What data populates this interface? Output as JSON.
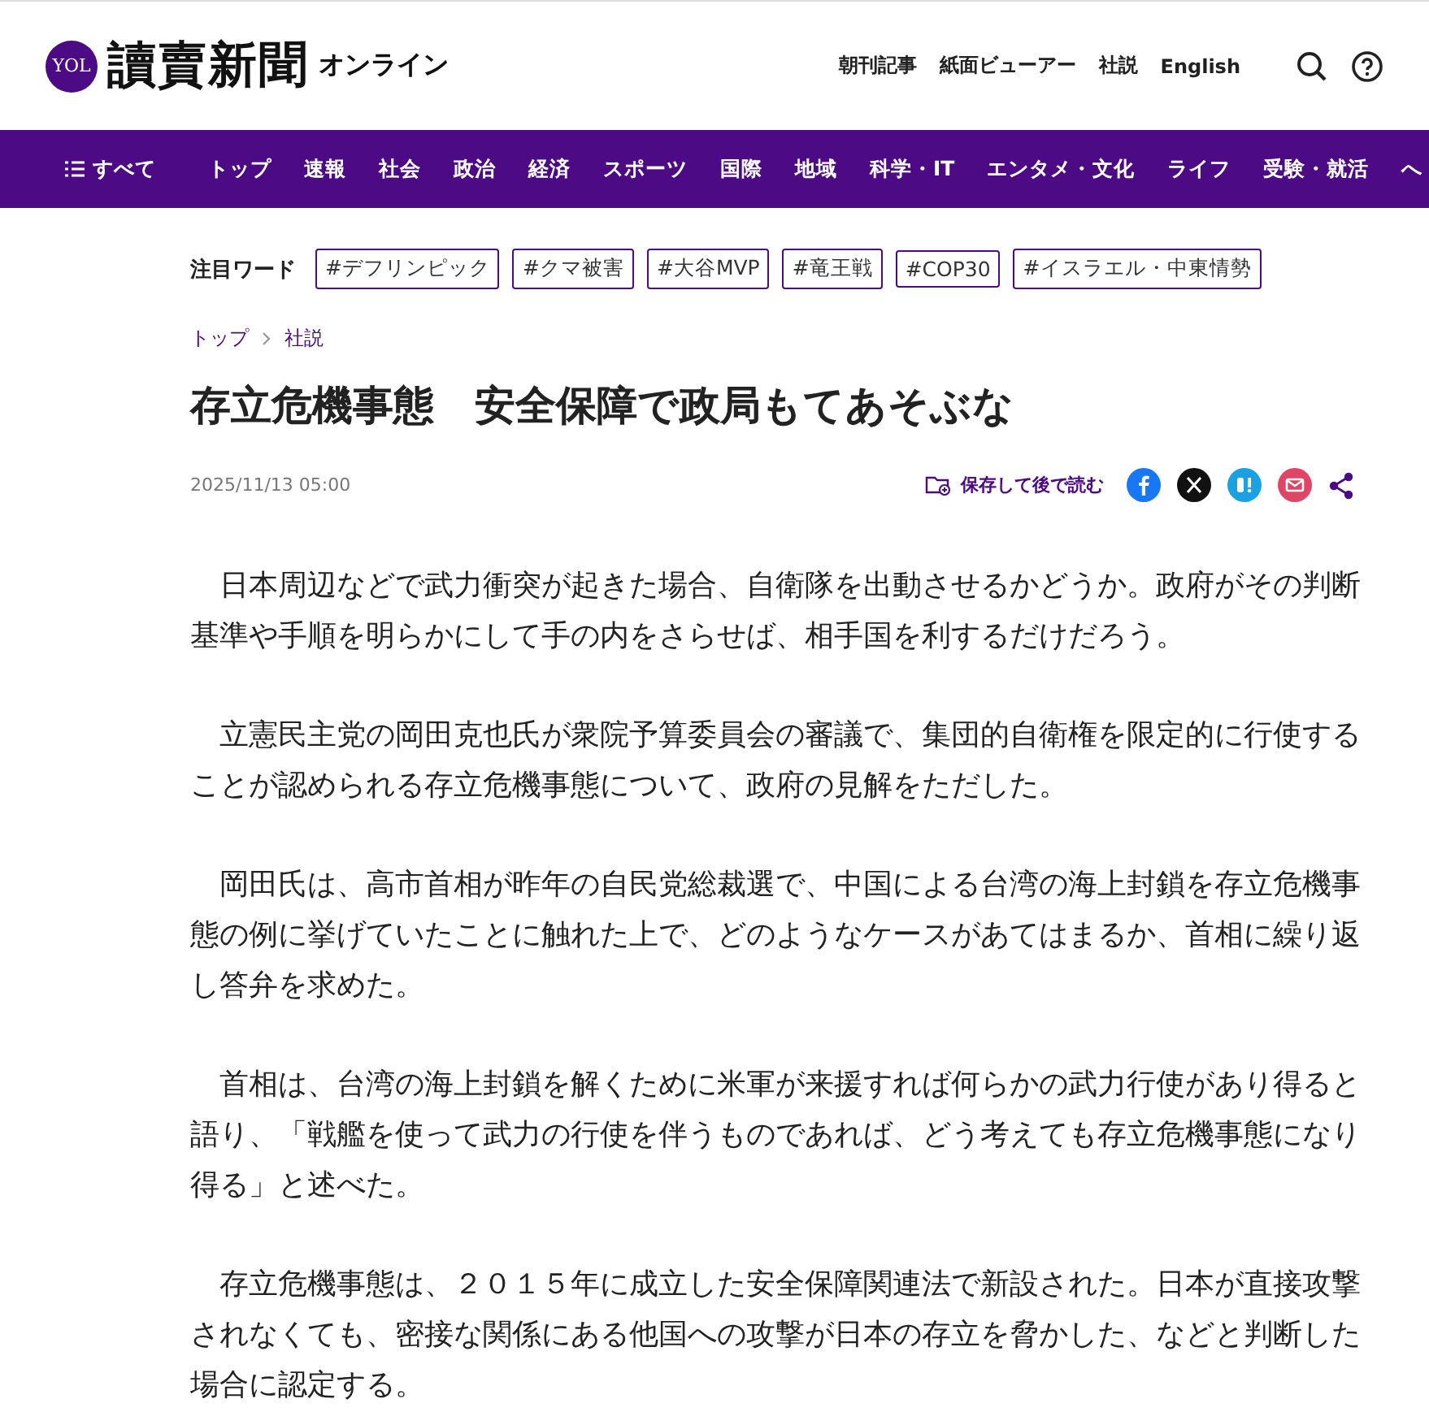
{
  "header": {
    "logo_mark": "YOL",
    "logo_title": "讀賣新聞",
    "logo_sub": "オンライン",
    "links": [
      "朝刊記事",
      "紙面ビューアー",
      "社説",
      "English"
    ]
  },
  "nav": {
    "menu_label": "すべて",
    "items": [
      "トップ",
      "速報",
      "社会",
      "政治",
      "経済",
      "スポーツ",
      "国際",
      "地域",
      "科学・IT",
      "エンタメ・文化",
      "ライフ",
      "受験・就活",
      "へ"
    ]
  },
  "keywords": {
    "label": "注目ワード",
    "tags": [
      "#デフリンピック",
      "#クマ被害",
      "#大谷MVP",
      "#竜王戦",
      "#COP30",
      "#イスラエル・中東情勢"
    ]
  },
  "breadcrumb": [
    "トップ",
    "社説"
  ],
  "article": {
    "title": "存立危機事態　安全保障で政局もてあそぶな",
    "date": "2025/11/13 05:00",
    "save_label": "保存して後で読む",
    "paragraphs": [
      "日本周辺などで武力衝突が起きた場合、自衛隊を出動させるかどうか。政府がその判断基準や手順を明らかにして手の内をさらせば、相手国を利するだけだろう。",
      "立憲民主党の岡田克也氏が衆院予算委員会の審議で、集団的自衛権を限定的に行使することが認められる存立危機事態について、政府の見解をただした。",
      "岡田氏は、高市首相が昨年の自民党総裁選で、中国による台湾の海上封鎖を存立危機事態の例に挙げていたことに触れた上で、どのようなケースがあてはまるか、首相に繰り返し答弁を求めた。",
      "首相は、台湾の海上封鎖を解くために米軍が来援すれば何らかの武力行使があり得ると語り、「戦艦を使って武力の行使を伴うものであれば、どう考えても存立危機事態になり得る」と述べた。",
      "存立危機事態は、２０１５年に成立した安全保障関連法で新設された。日本が直接攻撃されなくても、密接な関係にある他国への攻撃が日本の存立を脅かした、などと判断した場合に認定する。"
    ]
  }
}
